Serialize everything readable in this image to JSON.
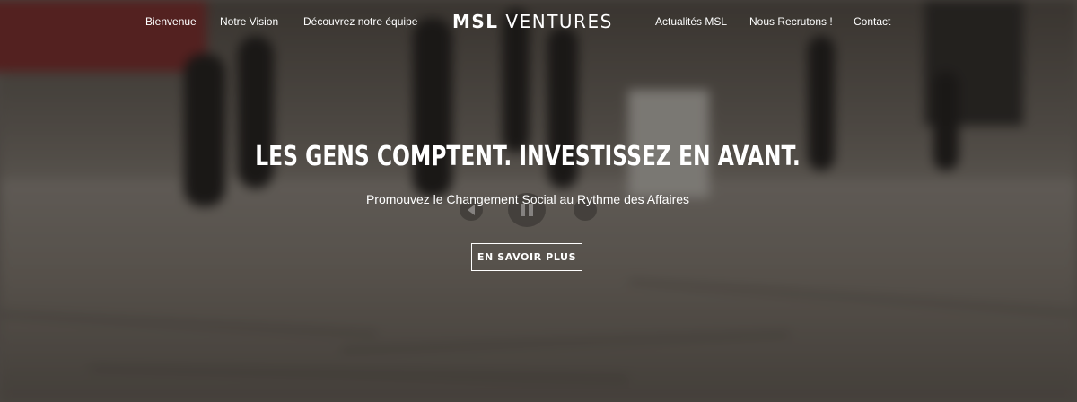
{
  "nav": {
    "items": [
      {
        "label": "Bienvenue"
      },
      {
        "label": "Notre Vision"
      },
      {
        "label": "Découvrez notre équipe"
      },
      {
        "label": "Actualités MSL"
      },
      {
        "label": "Nous Recrutons !"
      },
      {
        "label": "Contact"
      }
    ]
  },
  "logo": {
    "bold": "MSL",
    "regular": "VENTURES"
  },
  "hero": {
    "headline": "LES GENS COMPTENT. INVESTISSEZ EN AVANT.",
    "subtitle": "Promouvez le Changement Social au Rythme des Affaires",
    "cta_label": "EN SAVOIR PLUS"
  },
  "icons": {
    "prev": "previous-icon",
    "pause": "pause-icon",
    "next": "next-icon"
  },
  "colors": {
    "text": "#ffffff",
    "overlay": "#141210"
  }
}
